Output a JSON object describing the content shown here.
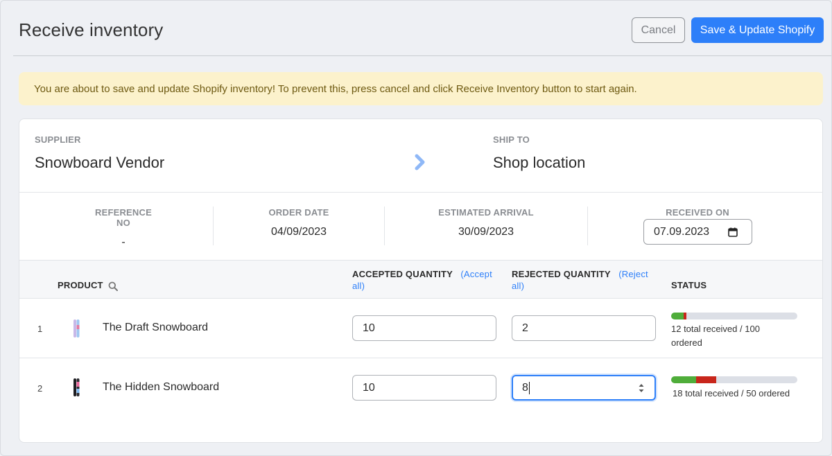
{
  "header": {
    "title": "Receive inventory",
    "cancel_label": "Cancel",
    "save_label": "Save & Update Shopify"
  },
  "alert": {
    "text": "You are about to save and update Shopify inventory! To prevent this, press cancel and click Receive Inventory button to start again."
  },
  "supplier": {
    "label": "SUPPLIER",
    "name": "Snowboard Vendor"
  },
  "ship_to": {
    "label": "SHIP TO",
    "name": "Shop location"
  },
  "meta": {
    "reference": {
      "label": "REFERENCE NO",
      "value": "-"
    },
    "order_date": {
      "label": "ORDER DATE",
      "value": "04/09/2023"
    },
    "estimated_arrival": {
      "label": "ESTIMATED ARRIVAL",
      "value": "30/09/2023"
    },
    "received_on": {
      "label": "RECEIVED ON",
      "value": "07.09.2023"
    }
  },
  "table": {
    "headers": {
      "product": "PRODUCT",
      "accepted": "ACCEPTED QUANTITY",
      "accept_all": "(Accept all)",
      "rejected": "REJECTED QUANTITY",
      "reject_all": "(Reject all)",
      "status": "STATUS"
    },
    "rows": [
      {
        "num": "1",
        "product": "The Draft Snowboard",
        "accepted": "10",
        "rejected": "2",
        "status_text": "12 total received / 100 ordered",
        "accepted_fraction": 0.1,
        "rejected_fraction": 0.02
      },
      {
        "num": "2",
        "product": "The Hidden Snowboard",
        "accepted": "10",
        "rejected": "8",
        "status_text": "18 total received / 50 ordered",
        "accepted_fraction": 0.2,
        "rejected_fraction": 0.16
      }
    ]
  },
  "colors": {
    "primary": "#2d7ff9",
    "accepted_bar": "#4fad3a",
    "rejected_bar": "#c8261b",
    "alert_bg": "#fcf2cc"
  },
  "icons": [
    "chevron-right-icon",
    "calendar-icon",
    "search-icon",
    "snowboard-thumbnail",
    "stepper-icon"
  ]
}
